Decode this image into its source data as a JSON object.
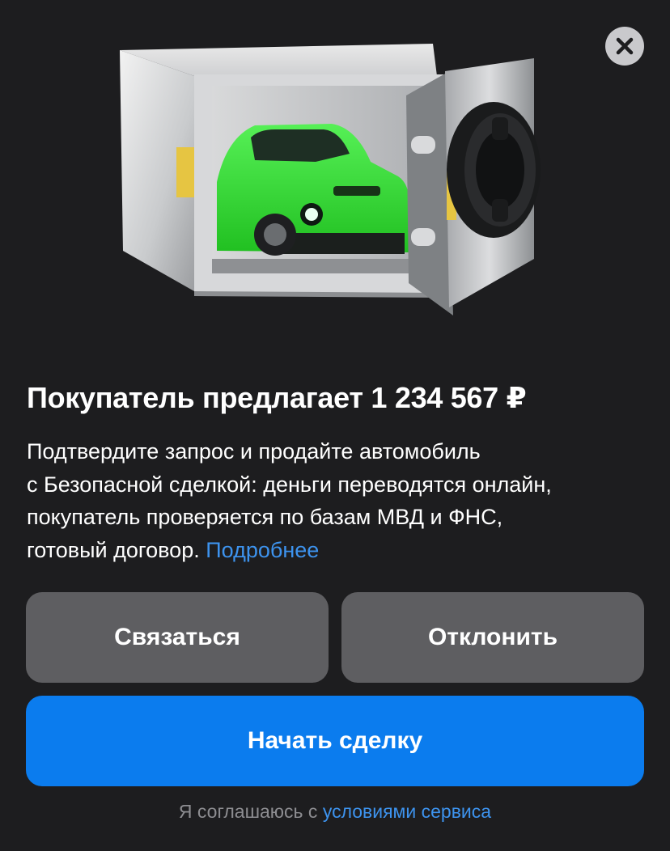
{
  "dialog": {
    "title": "Покупатель предлагает 1 234 567 ₽",
    "description_lines": [
      "Подтвердите запрос и продайте автомобиль",
      "с Безопасной сделкой: деньги переводятся онлайн,",
      "покупатель проверяется по базам МВД и ФНС,",
      "готовый договор."
    ],
    "more_link": "Подробнее",
    "close_icon": "close-icon",
    "illustration": "safe-with-green-car"
  },
  "buttons": {
    "contact": "Связаться",
    "decline": "Отклонить",
    "start_deal": "Начать сделку"
  },
  "footer": {
    "prefix": "Я соглашаюсь с",
    "terms_link": "условиями сервиса"
  },
  "colors": {
    "background": "#1d1d1f",
    "secondary_button": "#5e5e61",
    "primary_button": "#0b7cee",
    "link": "#3d93ee",
    "car": "#3ee83e"
  }
}
